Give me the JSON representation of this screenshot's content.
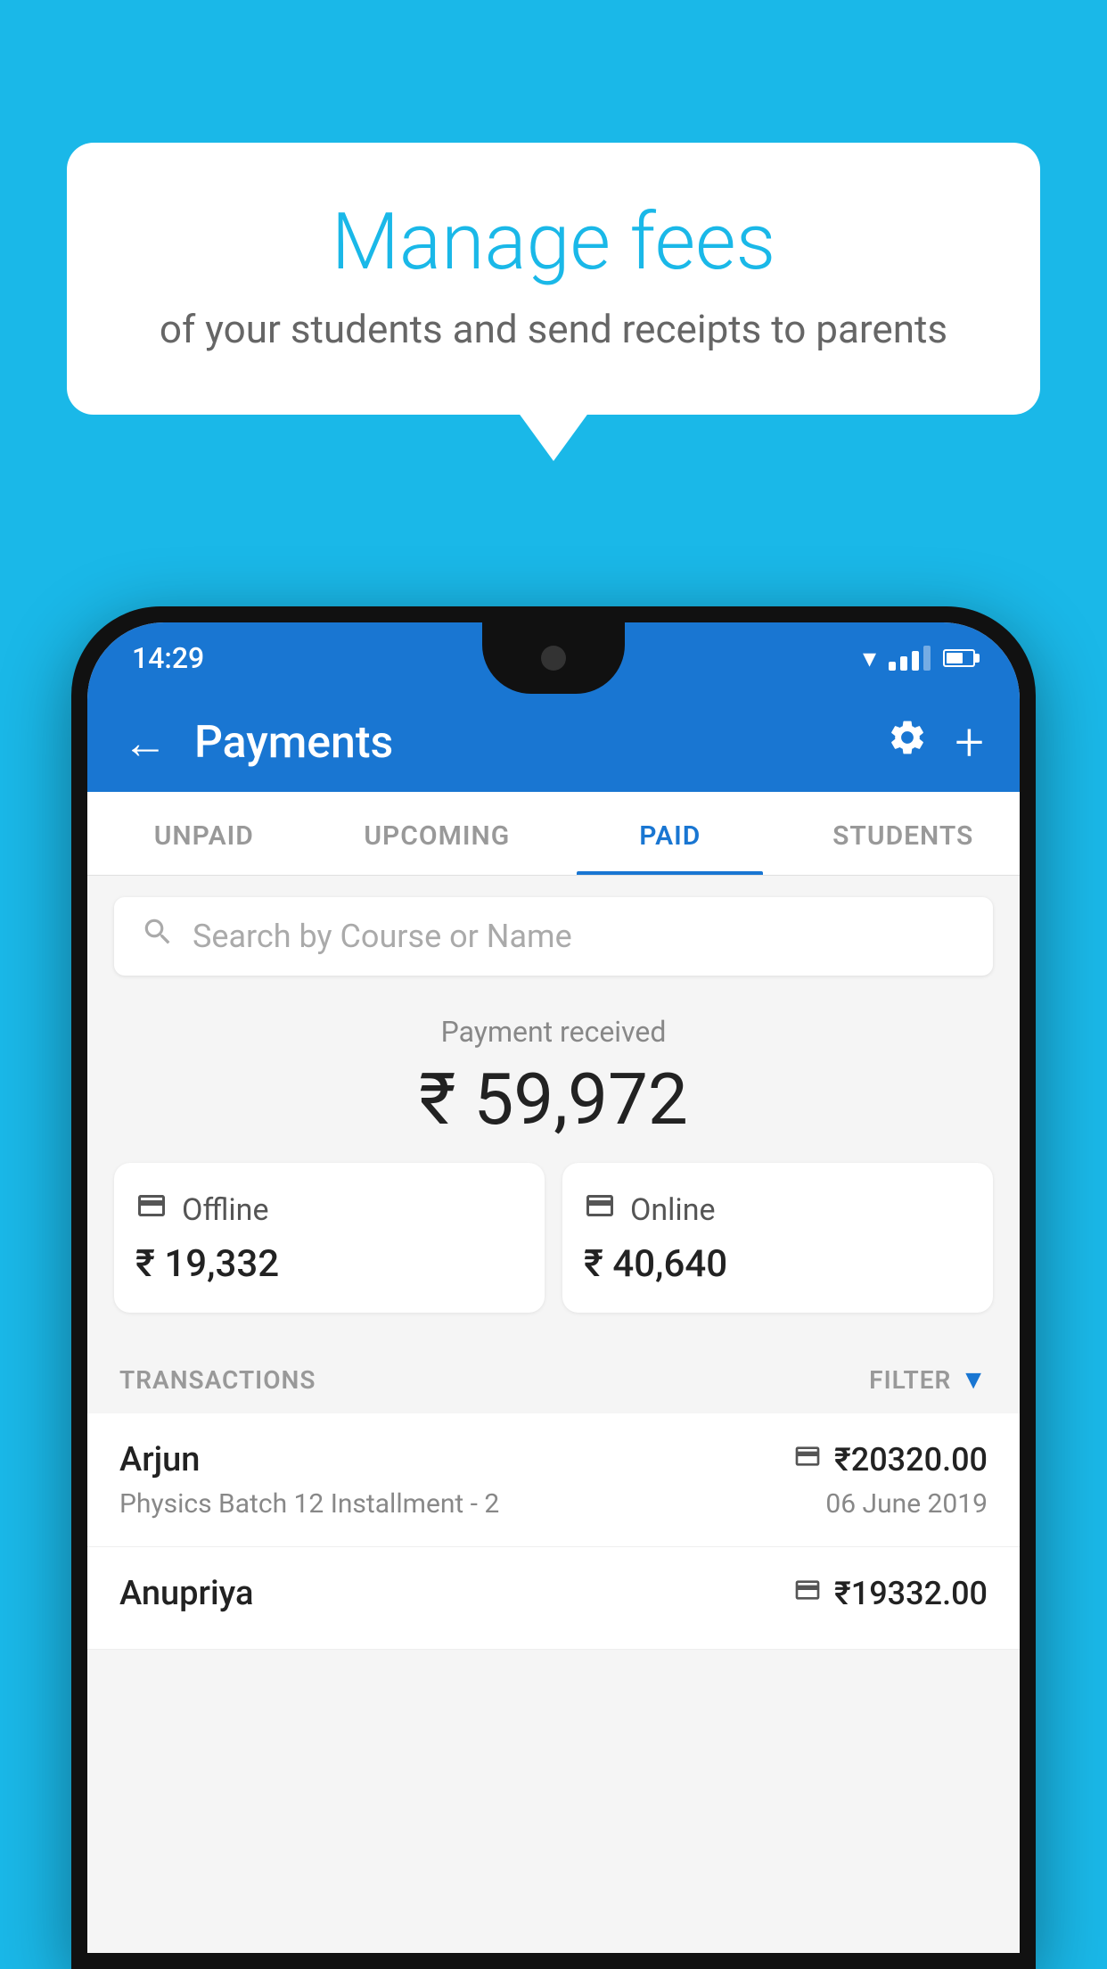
{
  "background_color": "#1ab8e8",
  "bubble": {
    "title": "Manage fees",
    "subtitle": "of your students and send receipts to parents"
  },
  "phone": {
    "status_bar": {
      "time": "14:29"
    },
    "app_bar": {
      "title": "Payments",
      "back_label": "←",
      "settings_label": "⚙",
      "add_label": "+"
    },
    "tabs": [
      {
        "label": "UNPAID",
        "active": false
      },
      {
        "label": "UPCOMING",
        "active": false
      },
      {
        "label": "PAID",
        "active": true
      },
      {
        "label": "STUDENTS",
        "active": false
      }
    ],
    "search": {
      "placeholder": "Search by Course or Name"
    },
    "payment_summary": {
      "label": "Payment received",
      "total": "₹ 59,972",
      "offline": {
        "label": "Offline",
        "amount": "₹ 19,332"
      },
      "online": {
        "label": "Online",
        "amount": "₹ 40,640"
      }
    },
    "transactions": {
      "section_label": "TRANSACTIONS",
      "filter_label": "FILTER",
      "items": [
        {
          "name": "Arjun",
          "course": "Physics Batch 12 Installment - 2",
          "amount": "₹20320.00",
          "date": "06 June 2019",
          "payment_type": "card"
        },
        {
          "name": "Anupriya",
          "course": "",
          "amount": "₹19332.00",
          "date": "",
          "payment_type": "offline"
        }
      ]
    }
  }
}
